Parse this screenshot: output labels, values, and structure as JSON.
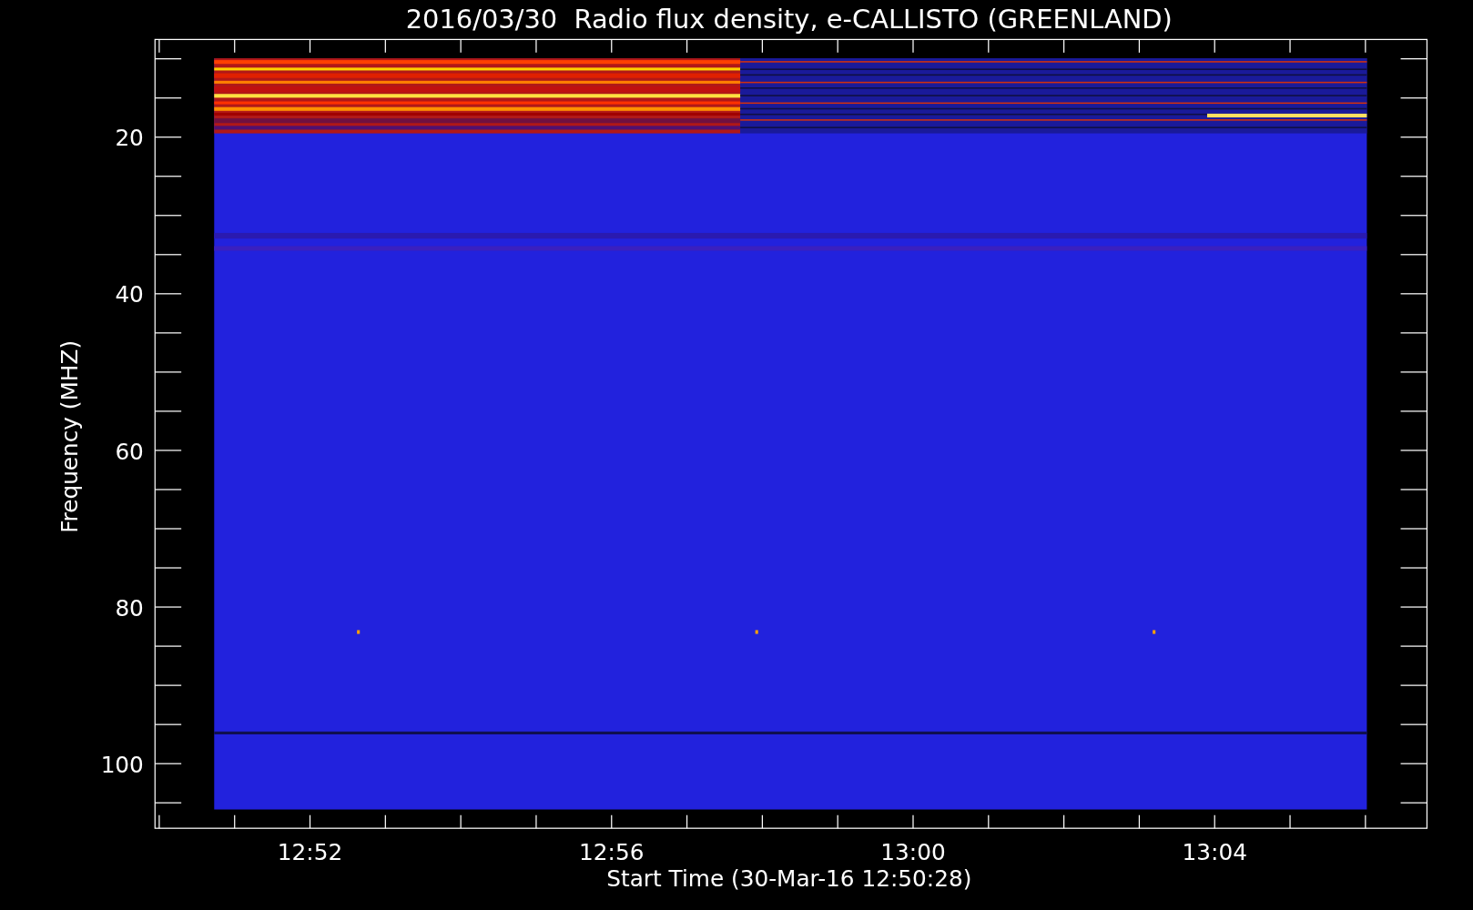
{
  "title": "2016/03/30  Radio flux density, e-CALLISTO (GREENLAND)",
  "y_axis": {
    "label": "Frequency (MHZ)",
    "ticks": [
      "20",
      "40",
      "60",
      "80",
      "100"
    ]
  },
  "x_axis": {
    "label": "Start Time (30-Mar-16 12:50:28)",
    "ticks": [
      "12:52",
      "12:56",
      "13:00",
      "13:04"
    ]
  }
}
